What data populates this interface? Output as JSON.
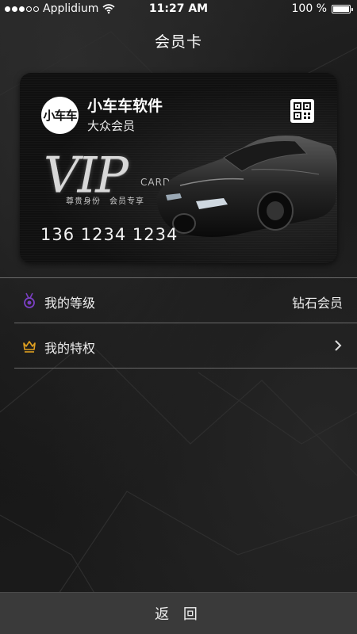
{
  "status_bar": {
    "carrier": "Applidium",
    "time": "11:27 AM",
    "battery": "100 %",
    "battery_level": 1.0
  },
  "nav": {
    "title": "会员卡"
  },
  "card": {
    "logo_text": "小车车",
    "name": "小车车软件",
    "level": "大众会员",
    "vip_text": "VIP",
    "vip_card_word": "CARD",
    "vip_sub": "尊贵身份　会员专享",
    "number": "136 1234 1234",
    "qr_icon": "qr-code-icon"
  },
  "rows": [
    {
      "icon": "medal-icon",
      "label": "我的等级",
      "value": "钻石会员",
      "icon_color": "#7b3fc4"
    },
    {
      "icon": "crown-icon",
      "label": "我的特权",
      "value": "",
      "icon_color": "#e0a020"
    }
  ],
  "footer": {
    "back_label": "返 回"
  }
}
